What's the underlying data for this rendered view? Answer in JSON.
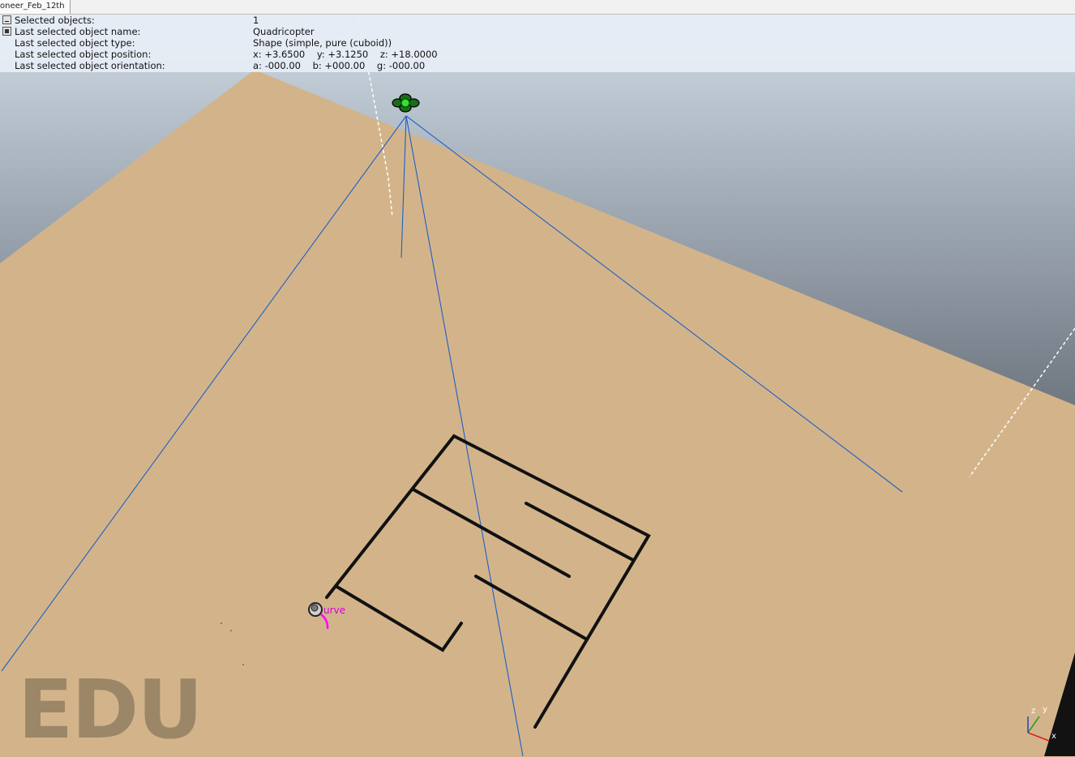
{
  "tab": {
    "title": "oneer_Feb_12th"
  },
  "info": {
    "rows": [
      {
        "label": "Selected objects:",
        "value": "1",
        "toggle": "collapse"
      },
      {
        "label": "Last selected object name:",
        "value": "Quadricopter",
        "toggle": "expand"
      },
      {
        "label": "Last selected object type:",
        "value": "Shape (simple, pure (cuboid))"
      },
      {
        "label": "Last selected object position:",
        "value": "x: +3.6500    y: +3.1250    z: +18.0000"
      },
      {
        "label": "Last selected object orientation:",
        "value": "a: -000.00    b: +000.00    g: -000.00"
      }
    ]
  },
  "scene": {
    "sky_colors": [
      "#d2dee9",
      "#6b737d"
    ],
    "floor_color": "#d3b48a",
    "wall_color": "#111111",
    "ray_color": "#1f5fc7",
    "path_color": "#ff00ff",
    "curve_label": "urve",
    "watermark": "EDU",
    "axes": {
      "x": "x",
      "y": "y",
      "z": "z"
    }
  }
}
